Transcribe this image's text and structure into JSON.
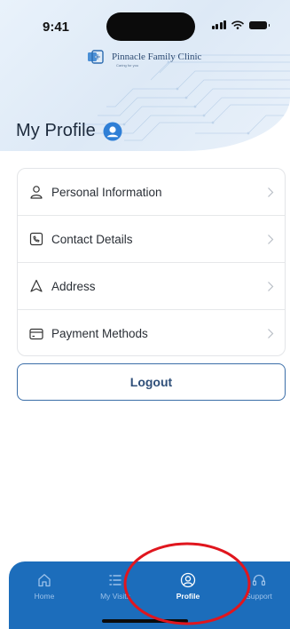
{
  "status_bar": {
    "time": "9:41"
  },
  "brand": {
    "name": "Pinnacle Family Clinic",
    "tagline": "Caring for you"
  },
  "page": {
    "title": "My Profile"
  },
  "menu": {
    "items": [
      {
        "label": "Personal Information",
        "icon": "person-icon"
      },
      {
        "label": "Contact Details",
        "icon": "contact-card-icon"
      },
      {
        "label": "Address",
        "icon": "location-pointer-icon"
      },
      {
        "label": "Payment Methods",
        "icon": "credit-card-icon"
      }
    ]
  },
  "logout": {
    "label": "Logout"
  },
  "tabs": [
    {
      "label": "Home",
      "icon": "home-icon"
    },
    {
      "label": "My Visits",
      "icon": "list-icon"
    },
    {
      "label": "Profile",
      "icon": "profile-icon",
      "active": true
    },
    {
      "label": "Support",
      "icon": "support-icon"
    }
  ],
  "colors": {
    "accent": "#1c6dbb",
    "tab_inactive": "#9cc2ea",
    "annotation": "#e0161e",
    "header_bg": "#e4eef9"
  }
}
